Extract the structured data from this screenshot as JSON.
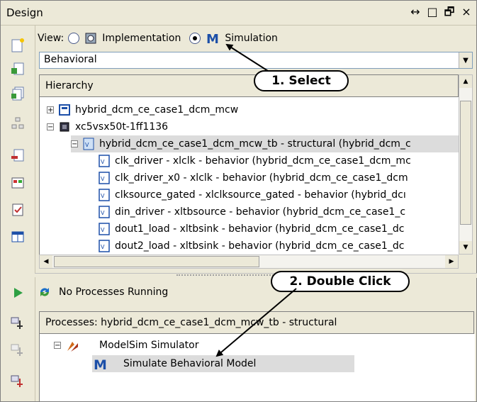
{
  "window": {
    "title": "Design",
    "buttons": [
      "↔",
      "□",
      "🗗",
      "×"
    ]
  },
  "view": {
    "label": "View:",
    "options": [
      {
        "label": "Implementation",
        "selected": false,
        "icon": "gear-chip-icon"
      },
      {
        "label": "Simulation",
        "selected": true,
        "icon": "modelsim-m-icon"
      }
    ]
  },
  "mode_select": {
    "value": "Behavioral"
  },
  "hierarchy": {
    "header": "Hierarchy",
    "rows": [
      {
        "text": "hybrid_dcm_ce_case1_dcm_mcw",
        "expander": "+",
        "icon": "file-icon",
        "indent": 0
      },
      {
        "text": "xc5vsx50t-1ff1136",
        "expander": "−",
        "icon": "chip-icon",
        "indent": 0
      },
      {
        "text": "hybrid_dcm_ce_case1_dcm_mcw_tb - structural (hybrid_dcm_c",
        "expander": "−",
        "icon": "vhdl-icon",
        "indent": 1,
        "selected": true
      },
      {
        "text": "clk_driver - xlclk - behavior (hybrid_dcm_ce_case1_dcm_mc",
        "icon": "vhdl-icon",
        "indent": 2
      },
      {
        "text": "clk_driver_x0 - xlclk - behavior (hybrid_dcm_ce_case1_dcm",
        "icon": "vhdl-icon",
        "indent": 2
      },
      {
        "text": "clksource_gated - xlclksource_gated - behavior (hybrid_dcı",
        "icon": "vhdl-icon",
        "indent": 2
      },
      {
        "text": "din_driver - xltbsource - behavior (hybrid_dcm_ce_case1_c",
        "icon": "vhdl-icon",
        "indent": 2
      },
      {
        "text": "dout1_load - xltbsink - behavior (hybrid_dcm_ce_case1_dc",
        "icon": "vhdl-icon",
        "indent": 2
      },
      {
        "text": "dout2_load - xltbsink - behavior (hybrid_dcm_ce_case1_dc",
        "icon": "vhdl-icon",
        "indent": 2
      }
    ]
  },
  "processes": {
    "status": "No Processes Running",
    "header": "Processes: hybrid_dcm_ce_case1_dcm_mcw_tb - structural",
    "rows": [
      {
        "text": "ModelSim Simulator",
        "expander": "−",
        "icon": "modelsim-tools-icon"
      },
      {
        "text": "Simulate Behavioral Model",
        "icon": "modelsim-m-icon",
        "selected": true
      }
    ]
  },
  "callouts": {
    "select": "1. Select",
    "double_click": "2. Double Click"
  },
  "colors": {
    "accent_blue": "#1c4fa8",
    "selection": "#dcdcdc",
    "panel": "#ece9d8"
  }
}
